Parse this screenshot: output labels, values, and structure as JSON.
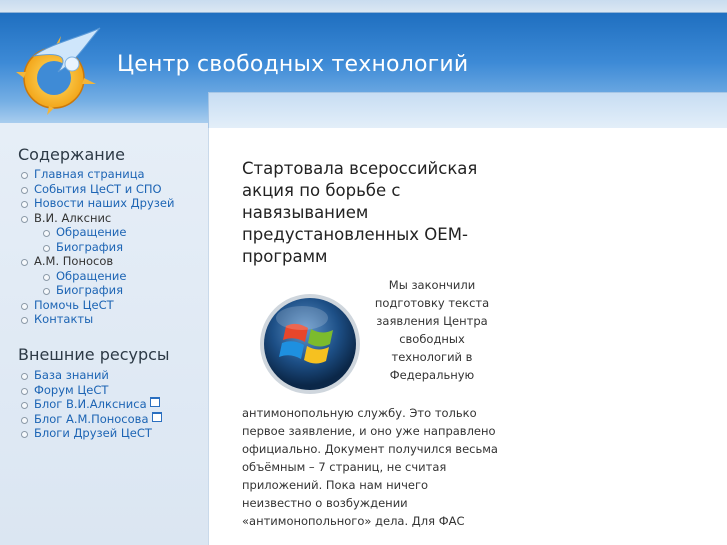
{
  "site": {
    "title": "Центр свободных технологий"
  },
  "sidebar": {
    "contents_title": "Содержание",
    "contents_items": [
      {
        "label": "Главная страница",
        "link": true
      },
      {
        "label": "События ЦеСТ и СПО",
        "link": true
      },
      {
        "label": "Новости наших Друзей",
        "link": true
      },
      {
        "label": "В.И. Алкснис",
        "link": false
      },
      {
        "label": "Обращение",
        "link": true,
        "sub": true
      },
      {
        "label": "Биография",
        "link": true,
        "sub": true
      },
      {
        "label": "А.М. Поносов",
        "link": false
      },
      {
        "label": "Обращение",
        "link": true,
        "sub": true
      },
      {
        "label": "Биография",
        "link": true,
        "sub": true
      },
      {
        "label": "Помочь ЦеСТ",
        "link": true
      },
      {
        "label": "Контакты",
        "link": true
      }
    ],
    "external_title": "Внешние ресурсы",
    "external_items": [
      {
        "label": "База знаний",
        "external": false
      },
      {
        "label": "Форум ЦеСТ",
        "external": false
      },
      {
        "label": "Блог В.И.Алксниса",
        "external": true
      },
      {
        "label": "Блог А.М.Поносова",
        "external": true
      },
      {
        "label": "Блоги Друзей ЦеСТ",
        "external": false
      }
    ]
  },
  "article": {
    "title": "Стартовала всероссийская акция по борьбе с навязыванием предустановленных OEM-программ",
    "para_right": "Мы закончили подготовку текста заявления Центра свободных технологий в Федеральную",
    "para_full": "антимонопольную службу. Это только первое заявление, и оно уже направлено официально. Документ получился весьма объёмным – 7 страниц, не считая приложений. Пока нам ничего неизвестно о возбуждении «антимонопольного» дела. Для ФАС"
  },
  "icons": {
    "logo": "cest-logo-icon",
    "image": "windows-logo-icon",
    "external": "external-link-icon"
  },
  "colors": {
    "header": "#3d8ad6",
    "link": "#1c64b4",
    "text": "#333333"
  }
}
